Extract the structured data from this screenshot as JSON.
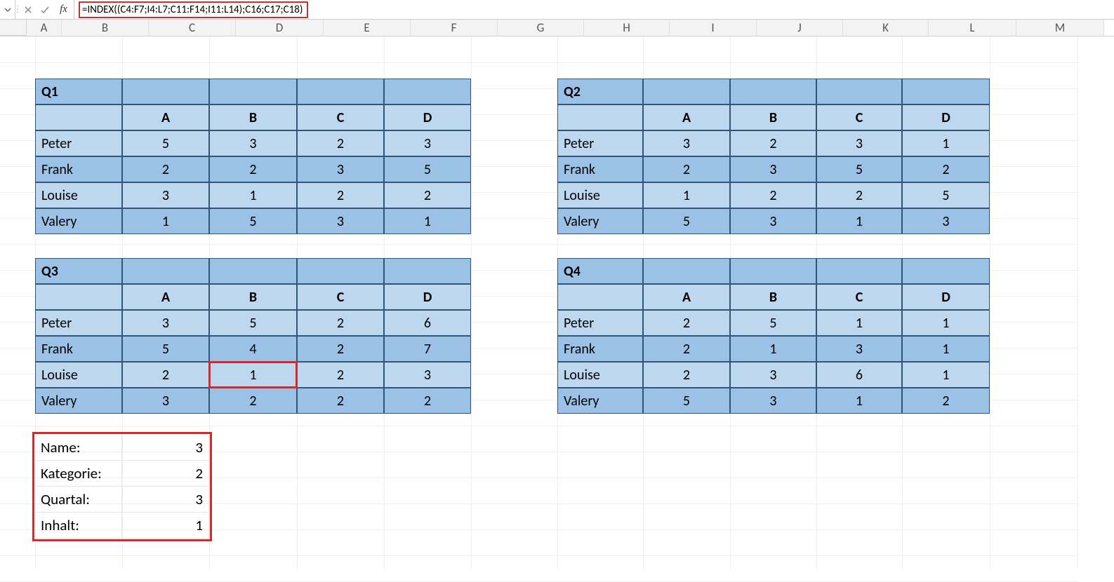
{
  "formula": "=INDEX((C4:F7;I4:L7;C11:F14;I11:L14);C16;C17;C18)",
  "fx": "fx",
  "columns": [
    "A",
    "B",
    "C",
    "D",
    "E",
    "F",
    "G",
    "H",
    "I",
    "J",
    "K",
    "L",
    "M"
  ],
  "col_widths": {
    "A": 50,
    "B": 124,
    "C": 124,
    "D": 125,
    "E": 124,
    "F": 124,
    "G": 123,
    "H": 122,
    "I": 124,
    "J": 123,
    "K": 122,
    "L": 125,
    "M": 125
  },
  "tables": {
    "q1": {
      "title": "Q1",
      "cols": [
        "A",
        "B",
        "C",
        "D"
      ],
      "rows": [
        "Peter",
        "Frank",
        "Louise",
        "Valery"
      ],
      "data": [
        [
          5,
          3,
          2,
          3
        ],
        [
          2,
          2,
          3,
          5
        ],
        [
          3,
          1,
          2,
          2
        ],
        [
          1,
          5,
          3,
          1
        ]
      ]
    },
    "q2": {
      "title": "Q2",
      "cols": [
        "A",
        "B",
        "C",
        "D"
      ],
      "rows": [
        "Peter",
        "Frank",
        "Louise",
        "Valery"
      ],
      "data": [
        [
          3,
          2,
          3,
          1
        ],
        [
          2,
          3,
          5,
          2
        ],
        [
          1,
          2,
          2,
          5
        ],
        [
          5,
          3,
          1,
          3
        ]
      ]
    },
    "q3": {
      "title": "Q3",
      "cols": [
        "A",
        "B",
        "C",
        "D"
      ],
      "rows": [
        "Peter",
        "Frank",
        "Louise",
        "Valery"
      ],
      "data": [
        [
          3,
          5,
          2,
          6
        ],
        [
          5,
          4,
          2,
          7
        ],
        [
          2,
          1,
          2,
          3
        ],
        [
          3,
          2,
          2,
          2
        ]
      ]
    },
    "q4": {
      "title": "Q4",
      "cols": [
        "A",
        "B",
        "C",
        "D"
      ],
      "rows": [
        "Peter",
        "Frank",
        "Louise",
        "Valery"
      ],
      "data": [
        [
          2,
          5,
          1,
          1
        ],
        [
          2,
          1,
          3,
          1
        ],
        [
          2,
          3,
          6,
          1
        ],
        [
          5,
          3,
          1,
          2
        ]
      ]
    }
  },
  "summary": [
    {
      "label": "Name:",
      "value": 3
    },
    {
      "label": "Kategorie:",
      "value": 2
    },
    {
      "label": "Quartal:",
      "value": 3
    },
    {
      "label": "Inhalt:",
      "value": 1
    }
  ]
}
